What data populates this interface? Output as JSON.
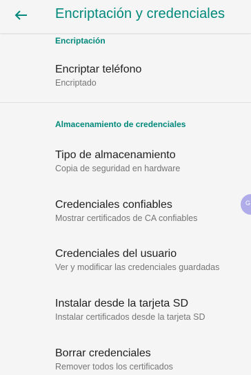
{
  "appbar": {
    "title": "Encriptación y credenciales",
    "back_icon": "arrow-left-icon"
  },
  "colors": {
    "accent": "#00897b",
    "background": "#f5f5f5",
    "primary_text": "#212121",
    "secondary_text": "#757575",
    "floating_bubble": "#a8a4e8"
  },
  "sections": [
    {
      "header": "Encriptación",
      "items": [
        {
          "title": "Encriptar teléfono",
          "summary": "Encriptado"
        }
      ]
    },
    {
      "header": "Almacenamiento de credenciales",
      "items": [
        {
          "title": "Tipo de almacenamiento",
          "summary": "Copia de seguridad en hardware"
        },
        {
          "title": "Credenciales confiables",
          "summary": "Mostrar certificados de CA confiables"
        },
        {
          "title": "Credenciales del usuario",
          "summary": "Ver y modificar las credenciales guardadas"
        },
        {
          "title": "Instalar desde la tarjeta SD",
          "summary": "Instalar certificados desde la tarjeta SD"
        },
        {
          "title": "Borrar credenciales",
          "summary": "Remover todos los certificados"
        }
      ]
    }
  ],
  "floating_bubble": {
    "text": "G"
  }
}
